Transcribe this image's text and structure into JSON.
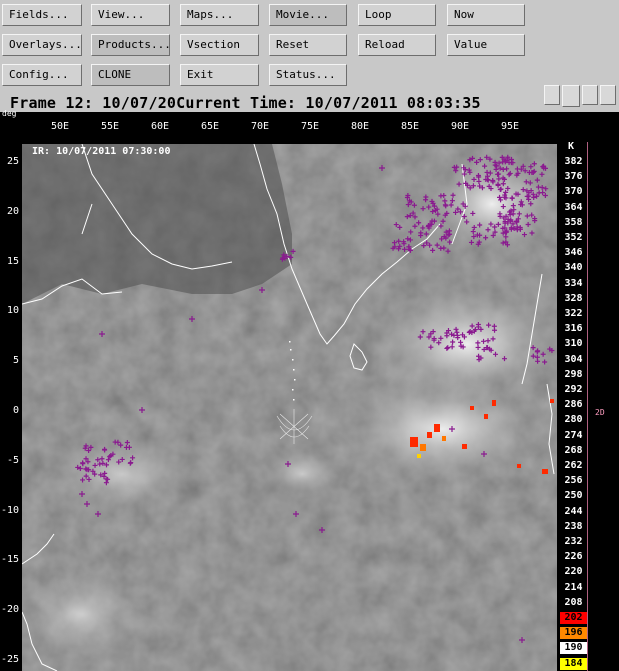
{
  "toolbar": {
    "row1": [
      "Fields...",
      "View...",
      "Maps...",
      "Movie...",
      "Loop",
      "Now"
    ],
    "row2": [
      "Overlays...",
      "Products...",
      "Vsection",
      "Reset",
      "Reload",
      "Value"
    ],
    "row3": [
      "Config...",
      "CLONE",
      "Exit",
      "Status..."
    ]
  },
  "frame_title": "Frame 12: 10/07/20Current Time: 10/07/2011 08:03:35",
  "plot": {
    "deg_label": "deg",
    "ir_label": "IR: 10/07/2011 07:30:00",
    "x_ticks": [
      "50E",
      "55E",
      "60E",
      "65E",
      "70E",
      "75E",
      "80E",
      "85E",
      "90E",
      "95E"
    ],
    "y_ticks": [
      "25",
      "20",
      "15",
      "10",
      "5",
      "0",
      "-5",
      "-10",
      "-15",
      "-20",
      "-25"
    ],
    "unit": "K",
    "side_label": "2D"
  },
  "scale": {
    "labels": [
      "382",
      "376",
      "370",
      "364",
      "358",
      "352",
      "346",
      "340",
      "334",
      "328",
      "322",
      "316",
      "310",
      "304",
      "298",
      "292",
      "286",
      "280",
      "274",
      "268",
      "262",
      "256",
      "250",
      "244",
      "238",
      "232",
      "226",
      "220",
      "214",
      "208",
      "202",
      "196",
      "190",
      "184"
    ],
    "colors": {
      "default_bg": "#000000",
      "default_fg": "#ffffff",
      "highlight_202": "#ff0000",
      "highlight_196": "#ff8800",
      "highlight_190": "#ffffff",
      "highlight_184": "#ffff00"
    }
  },
  "colors": {
    "lightning": "#8a1a8f",
    "cold_cloud": "#ff2a00",
    "coast": "#ffffff"
  }
}
